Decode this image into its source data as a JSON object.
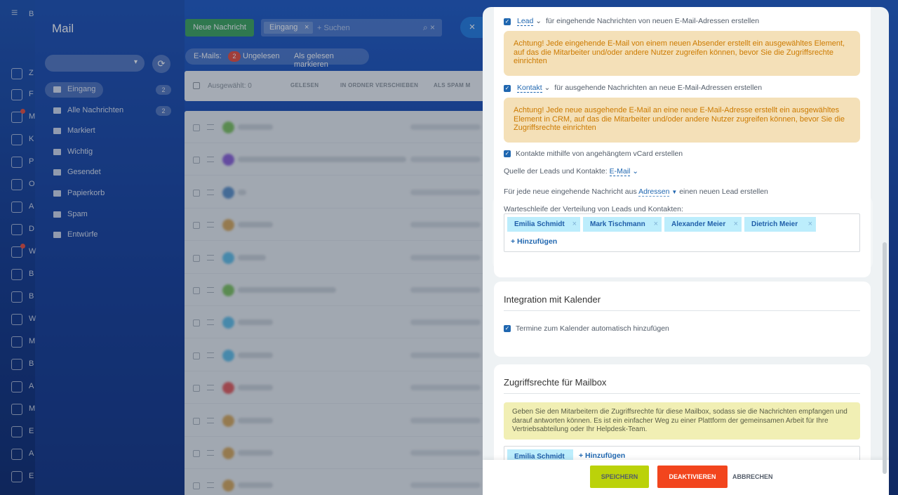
{
  "mail": {
    "title": "Mail",
    "folders": [
      {
        "label": "Eingang",
        "count": "2",
        "icon": "inbox-icon"
      },
      {
        "label": "Alle Nachrichten",
        "count": "2",
        "icon": "folder-icon"
      },
      {
        "label": "Markiert",
        "icon": "folder-icon"
      },
      {
        "label": "Wichtig",
        "icon": "folder-icon"
      },
      {
        "label": "Gesendet",
        "icon": "sent-icon"
      },
      {
        "label": "Papierkorb",
        "icon": "trash-icon"
      },
      {
        "label": "Spam",
        "icon": "spam-icon"
      },
      {
        "label": "Entwürfe",
        "icon": "draft-icon"
      }
    ],
    "toolbar": {
      "new_message": "Neue Nachricht",
      "search_filter": "Eingang",
      "search_placeholder": "+ Suchen"
    },
    "emails_bar": {
      "label": "E-Mails:",
      "count": "2",
      "unread": "Ungelesen",
      "mark_read": "Als gelesen markieren"
    },
    "action_bar": {
      "selected": "Ausgewählt: 0",
      "read": "GELESEN",
      "move": "IN ORDNER VERSCHIEBEN",
      "spam": "ALS SPAM M"
    }
  },
  "rail": {
    "letters": [
      "B",
      "Z",
      "F",
      "M",
      "K",
      "P",
      "O",
      "A",
      "D",
      "W",
      "B",
      "B",
      "W",
      "M",
      "B",
      "A",
      "M",
      "E",
      "A",
      "E"
    ],
    "badges": {
      "top_left": "1",
      "top_right": "5"
    }
  },
  "slider": {
    "crm": {
      "lead_option": "Lead",
      "lead_text": "für eingehende Nachrichten von neuen E-Mail-Adressen erstellen",
      "lead_warning": "Achtung! Jede eingehende E-Mail von einem neuen Absender erstellt ein ausgewähltes Element, auf das die Mitarbeiter und/oder andere Nutzer zugreifen können, bevor Sie die Zugriffsrechte einrichten",
      "contact_option": "Kontakt",
      "contact_text": "für ausgehende Nachrichten an neue E-Mail-Adressen erstellen",
      "contact_warning": "Achtung! Jede neue ausgehende E-Mail an eine neue E-Mail-Adresse erstellt ein ausgewähltes Element in CRM, auf das die Mitarbeiter und/oder andere Nutzer zugreifen können, bevor Sie die Zugriffsrechte einrichten",
      "vcard": "Kontakte mithilfe von angehängtem vCard erstellen",
      "source_label": "Quelle der Leads und Kontakte:",
      "source_value": "E-Mail",
      "per_message_prefix": "Für jede neue eingehende Nachricht aus",
      "per_message_link": "Adressen",
      "per_message_suffix": "einen neuen Lead erstellen",
      "queue_title": "Warteschleife der Verteilung von Leads und Kontakten:",
      "queue_members": [
        "Emilia Schmidt",
        "Mark Tischmann",
        "Alexander Meier",
        "Dietrich Meier"
      ],
      "add_label": "+ Hinzufügen"
    },
    "calendar": {
      "title": "Integration mit Kalender",
      "option": "Termine zum Kalender automatisch hinzufügen"
    },
    "access": {
      "title": "Zugriffsrechte für Mailbox",
      "info": "Geben Sie den Mitarbeitern die Zugriffsrechte für diese Mailbox, sodass sie die Nachrichten empfangen und darauf antworten können. Es ist ein einfacher Weg zu einer Plattform der gemeinsamen Arbeit für Ihre Vertriebsabteilung oder Ihr Helpdesk-Team.",
      "member": "Emilia Schmidt",
      "add_label": "+ Hinzufügen"
    },
    "footer": {
      "save": "SPEICHERN",
      "deactivate": "DEAKTIVIEREN",
      "cancel": "ABBRECHEN"
    }
  }
}
